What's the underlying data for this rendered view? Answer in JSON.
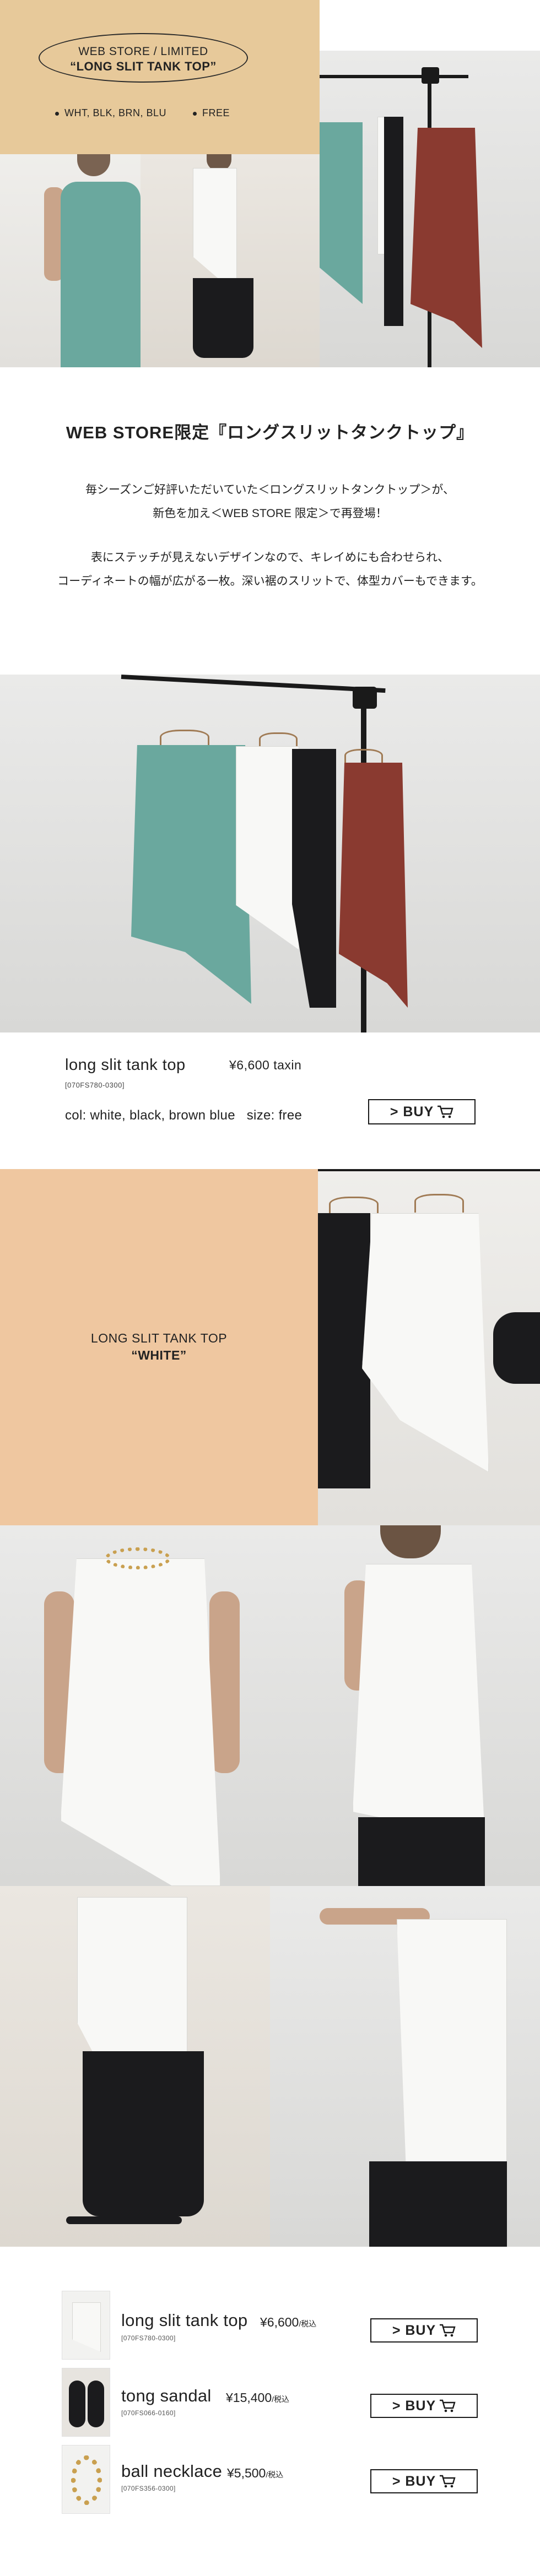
{
  "hero": {
    "oval_line1": "WEB STORE / LIMITED",
    "oval_line2": "“LONG SLIT TANK TOP”",
    "colors": "WHT, BLK, BRN, BLU",
    "size": "FREE"
  },
  "intro": {
    "title": "WEB STORE限定『ロングスリットタンクトップ』",
    "line1": "毎シーズンご好評いただいていた＜ロングスリットタンクトップ＞が、",
    "line2": "新色を加え＜WEB STORE 限定＞で再登場！",
    "line3": "表にステッチが見えないデザインなので、キレイめにも合わせられ、",
    "line4": "コーディネートの幅が広がる一枚。深い裾のスリットで、体型カバーもできます。"
  },
  "product_main": {
    "name": "long slit tank top",
    "price": "¥6,600 taxin",
    "code": "[070FS780-0300]",
    "colors_size": "col: white, black, brown blue   size: free",
    "buy_label": "> BUY"
  },
  "white_section": {
    "line1": "LONG SLIT TANK TOP",
    "line2": "“WHITE”"
  },
  "items": [
    {
      "name": "long slit tank top",
      "price": "¥6,600",
      "tax": "/税込",
      "code": "[070FS780-0300]",
      "buy_label": "> BUY"
    },
    {
      "name": "tong sandal",
      "price": "¥15,400",
      "tax": "/税込",
      "code": "[070FS066-0160]",
      "buy_label": "> BUY"
    },
    {
      "name": "ball necklace",
      "price": "¥5,500",
      "tax": "/税込",
      "code": "[070FS356-0300]",
      "buy_label": "> BUY"
    }
  ],
  "colors": {
    "hero_tan": "#e7c99a",
    "peach": "#efc7a0",
    "teal": "#6aa89e",
    "brown": "#8a3a30",
    "black": "#1b1b1d"
  },
  "icons": [
    "cart-icon"
  ]
}
